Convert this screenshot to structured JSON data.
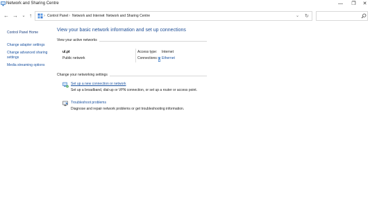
{
  "window": {
    "title": "Network and Sharing Centre",
    "minimize_glyph": "—",
    "maximize_glyph": "❐",
    "close_glyph": "✕"
  },
  "toolbar": {
    "back_glyph": "←",
    "forward_glyph": "→",
    "recent_glyph": "⌄",
    "up_glyph": "↑",
    "refresh_glyph": "↻",
    "dropdown_glyph": "⌄",
    "breadcrumbs": [
      "Control Panel",
      "Network and Internet",
      "Network and Sharing Centre"
    ],
    "separator": "›",
    "search_placeholder": ""
  },
  "sidebar": {
    "items": [
      {
        "label": "Control Panel Home"
      },
      {
        "label": "Change adapter settings"
      },
      {
        "label": "Change advanced sharing"
      },
      {
        "label": "settings"
      },
      {
        "label": "Media streaming options"
      }
    ]
  },
  "main": {
    "title": "View your basic network information and set up connections",
    "active_networks_header": "View your active networks",
    "network": {
      "name": "ul.pt",
      "type": "Public network",
      "access_type_label": "Access type:",
      "access_type_value": "Internet",
      "connections_label": "Connections:",
      "connections_value": "Ethernet"
    },
    "change_settings_header": "Change your networking settings",
    "tasks": [
      {
        "icon": "new-connection-icon",
        "link": "Set up a new connection or network",
        "desc": "Set up a broadband, dial-up or VPN connection, or set up a router or access point."
      },
      {
        "icon": "troubleshoot-icon",
        "link": "Troubleshoot problems",
        "desc": "Diagnose and repair network problems or get troubleshooting information."
      }
    ]
  },
  "colors": {
    "link": "#1a52a0",
    "title": "#1e4e96",
    "background": "#ffffff"
  }
}
